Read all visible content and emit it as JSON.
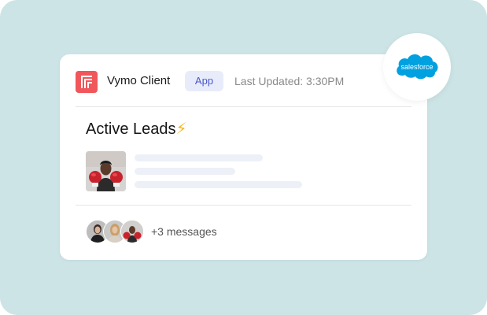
{
  "card": {
    "app_name": "Vymo Client",
    "badge": "App",
    "last_updated": "Last Updated: 3:30PM",
    "section_title": "Active Leads",
    "section_emoji": "⚡",
    "messages": "+3 messages"
  },
  "salesforce": {
    "logo_text": "salesforce"
  },
  "colors": {
    "background": "#cce4e5",
    "app_logo": "#f0565a",
    "badge_bg": "#e8ecfa",
    "badge_text": "#4a58c9",
    "salesforce_blue": "#00a1e0"
  },
  "icons": {
    "app_logo": "vymo-logo-icon",
    "salesforce": "salesforce-cloud-icon"
  }
}
